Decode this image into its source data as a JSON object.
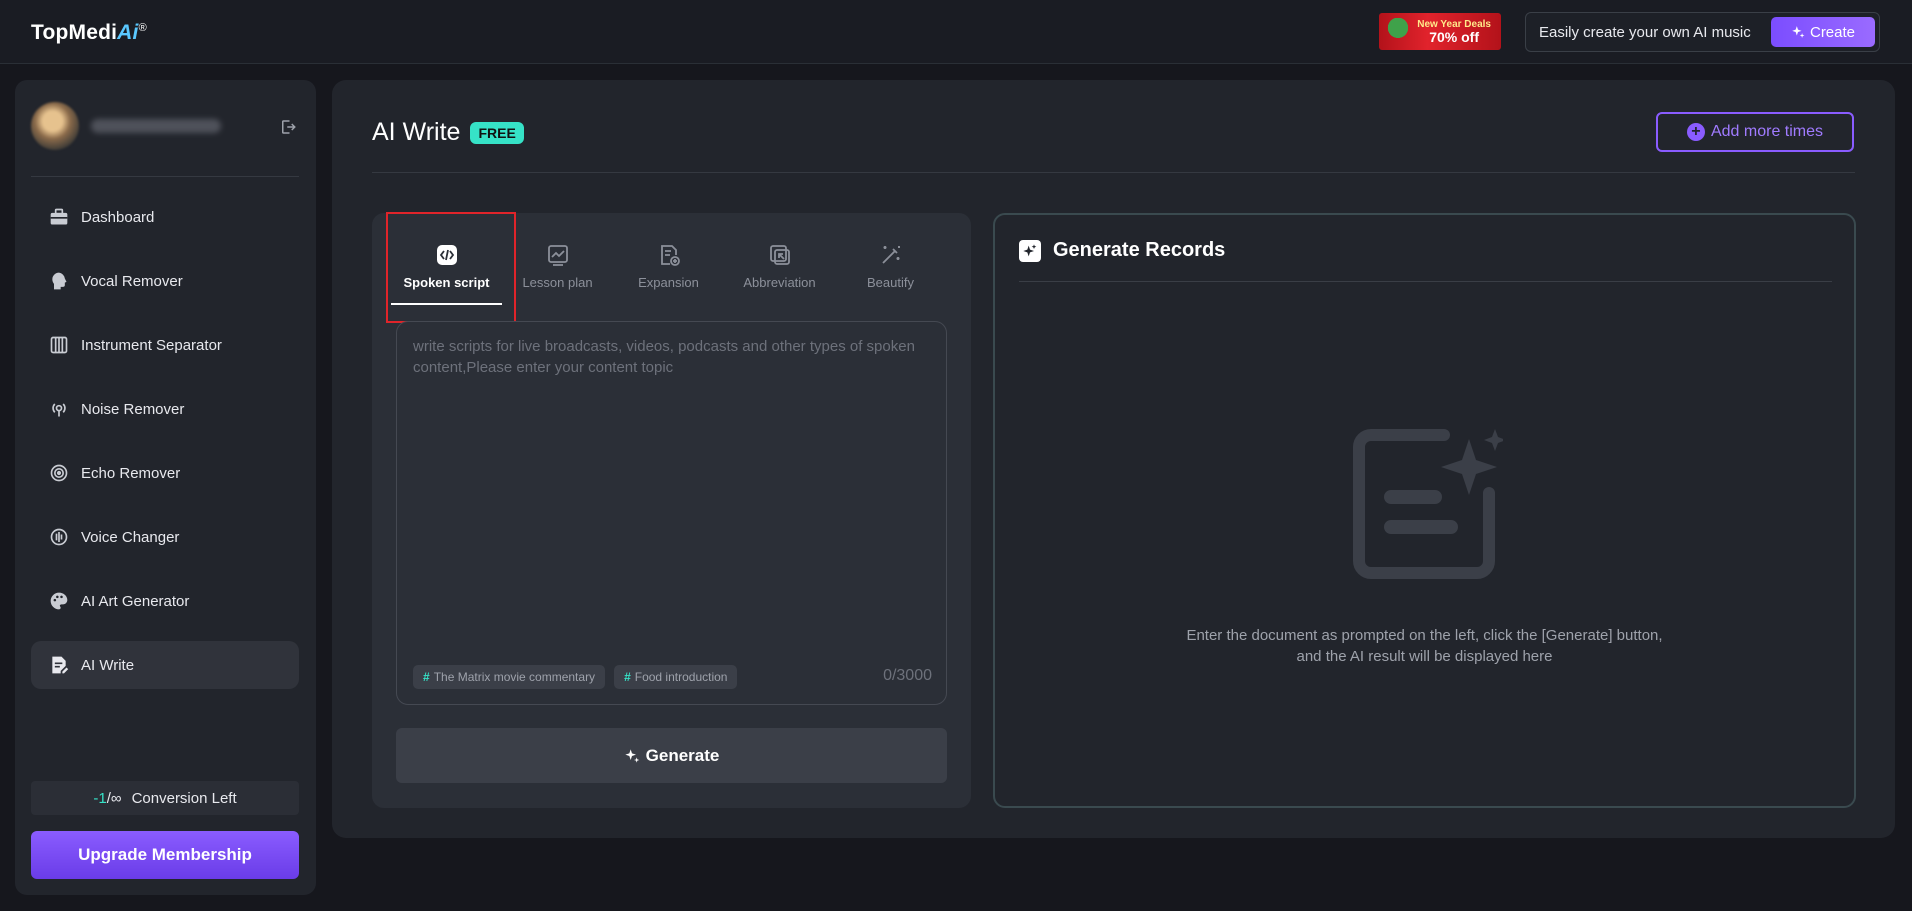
{
  "header": {
    "logo_text": "TopMedi",
    "logo_ai": "Ai",
    "logo_reg": "®",
    "promo": {
      "line1": "New Year Deals",
      "line2": "70% off"
    },
    "cta_text": "Easily create your own AI music",
    "create_label": "Create"
  },
  "sidebar": {
    "items": [
      {
        "label": "Dashboard",
        "icon": "briefcase-icon"
      },
      {
        "label": "Vocal Remover",
        "icon": "head-icon"
      },
      {
        "label": "Instrument Separator",
        "icon": "piano-icon"
      },
      {
        "label": "Noise Remover",
        "icon": "broadcast-icon"
      },
      {
        "label": "Echo Remover",
        "icon": "echo-icon"
      },
      {
        "label": "Voice Changer",
        "icon": "voice-changer-icon"
      },
      {
        "label": "AI Art Generator",
        "icon": "palette-icon"
      },
      {
        "label": "AI Write",
        "icon": "write-icon"
      }
    ],
    "conversion_count": "-1",
    "conversion_inf": "/∞",
    "conversion_label": "Conversion Left",
    "upgrade_label": "Upgrade Membership"
  },
  "main": {
    "title": "AI Write",
    "badge": "FREE",
    "add_more_label": "Add more times",
    "tabs": [
      {
        "label": "Spoken script",
        "icon": "code-icon"
      },
      {
        "label": "Lesson plan",
        "icon": "chart-icon"
      },
      {
        "label": "Expansion",
        "icon": "doc-plus-icon"
      },
      {
        "label": "Abbreviation",
        "icon": "shrink-icon"
      },
      {
        "label": "Beautify",
        "icon": "magic-wand-icon"
      }
    ],
    "input": {
      "placeholder": "write scripts for live broadcasts, videos, podcasts and other types of spoken content,Please enter your content topic",
      "value": ""
    },
    "chips": [
      "The Matrix movie commentary",
      "Food introduction"
    ],
    "counter": "0/3000",
    "generate_label": "Generate"
  },
  "records": {
    "title": "Generate Records",
    "empty_text_line1": "Enter the document as prompted on the left, click the [Generate] button,",
    "empty_text_line2": "and the AI result will be displayed here"
  }
}
